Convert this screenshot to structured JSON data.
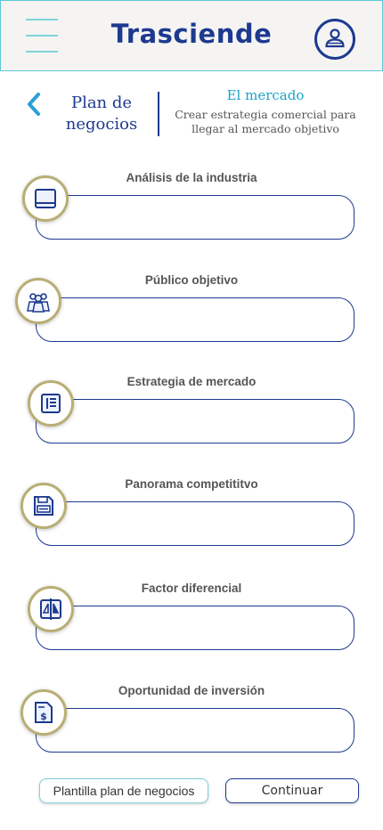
{
  "header": {
    "title": "Trasciende",
    "menu_icon": "hamburger-menu-icon",
    "profile_icon": "user-profile-icon"
  },
  "section": {
    "back_icon": "chevron-left-icon",
    "title": "Plan de negocios",
    "subtitle": "El mercado",
    "description": "Crear estrategia comercial para llegar al mercado objetivo"
  },
  "fields": [
    {
      "label": "Análisis de la industria",
      "value": "",
      "icon": "panel-icon"
    },
    {
      "label": "Público objetivo",
      "value": "",
      "icon": "group-icon"
    },
    {
      "label": "Estrategia de mercado",
      "value": "",
      "icon": "list-document-icon"
    },
    {
      "label": "Panorama competititvo",
      "value": "",
      "icon": "floppy-disk-icon"
    },
    {
      "label": "Factor diferencial",
      "value": "",
      "icon": "compare-icon"
    },
    {
      "label": "Oportunidad de inversión",
      "value": "",
      "icon": "invoice-dollar-icon"
    }
  ],
  "actions": {
    "template_label": "Plantilla plan de negocios",
    "continue_label": "Continuar"
  },
  "colors": {
    "primary": "#1d3a8f",
    "accent": "#5fc9d3",
    "icon_ring": "#b9ae73",
    "subtitle": "#1aa3c9"
  }
}
